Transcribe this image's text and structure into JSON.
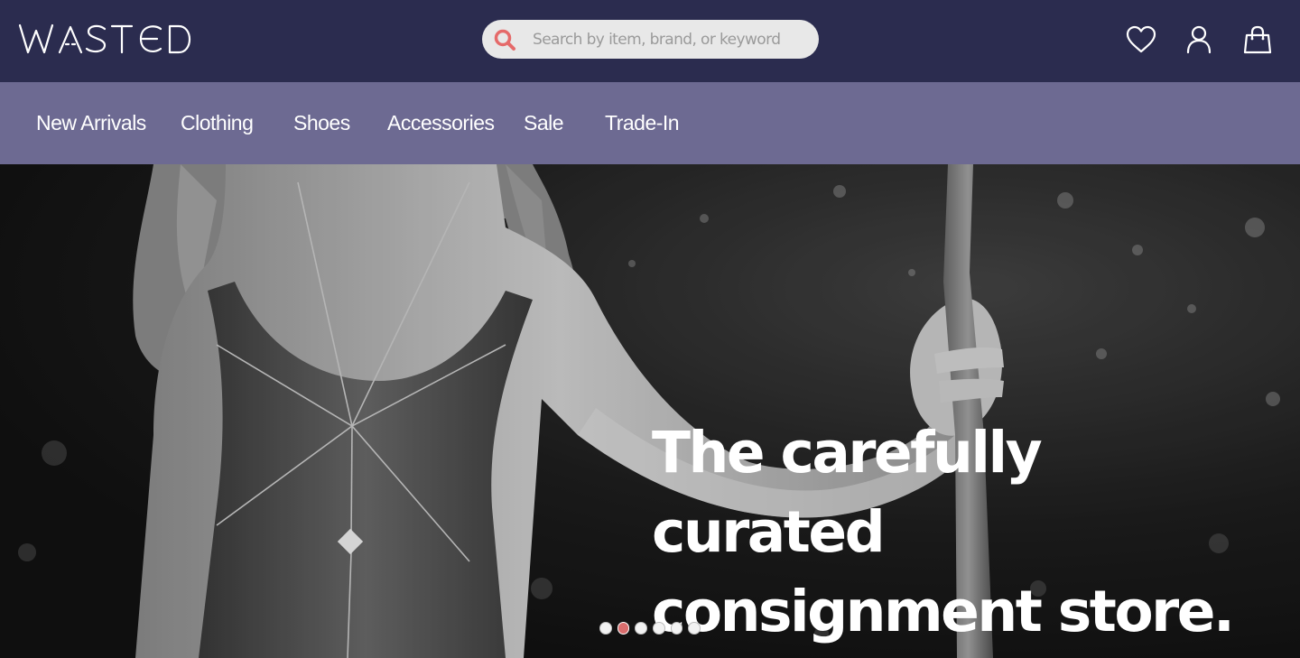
{
  "brand": {
    "logo_text": "WASTED"
  },
  "search": {
    "placeholder": "Search by item, brand, or keyword"
  },
  "header_icons": [
    "heart-icon",
    "user-icon",
    "shopping-bag-icon"
  ],
  "nav": {
    "items": [
      {
        "label": "New Arrivals"
      },
      {
        "label": "Clothing"
      },
      {
        "label": "Shoes"
      },
      {
        "label": "Accessories"
      },
      {
        "label": "Sale"
      },
      {
        "label": "Trade-In"
      }
    ]
  },
  "hero": {
    "headline_line1": "The carefully curated",
    "headline_line2": "consignment store.",
    "slide_count": 6,
    "active_slide": 2
  },
  "colors": {
    "header_bg": "#2b2c4f",
    "nav_bg": "#6d6a92",
    "search_accent": "#e56a6a",
    "active_dot": "#d96d6d"
  }
}
